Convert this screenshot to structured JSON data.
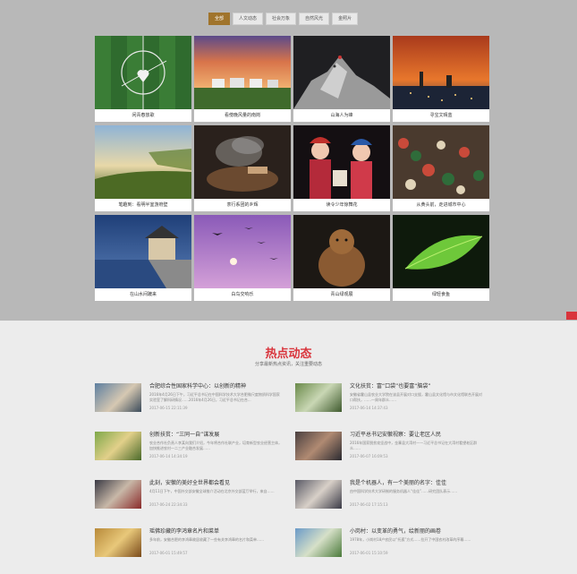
{
  "tabs": [
    "全部",
    "人文动态",
    "社会万象",
    "自然风光",
    "金照片"
  ],
  "photos": [
    {
      "caption": "闲青春放歌"
    },
    {
      "caption": "看傍晚风量的南岗"
    },
    {
      "caption": "山海人为峰"
    },
    {
      "caption": "寻宝文晴蓝"
    },
    {
      "caption": "笔趣到：看明半室游府壁"
    },
    {
      "caption": "茶行系团的乡辉"
    },
    {
      "caption": "读令少年惊舞花"
    },
    {
      "caption": "从黄头前，走进城市中心"
    },
    {
      "caption": "在山水间踱来"
    },
    {
      "caption": "白鸟交响乐"
    },
    {
      "caption": "青山绿观展"
    },
    {
      "caption": "绿轻食鱼"
    }
  ],
  "news": {
    "title": "热点动态",
    "subtitle": "分享最新热点资讯，关注重要动态",
    "items": [
      {
        "title": "合肥综合性国家科学中心：以创新的精神",
        "desc": "2016年4月26日下午，习近平总书记在中国科学技术大学合肥微尺度物质科学国家实验室了解科研情况……2016年4月26日，习近平总书记在合...",
        "date": "2017-06-15 22:11:39"
      },
      {
        "title": "文化扶贫：富“口袋”也要富“脑袋”",
        "desc": "安徽省霍山县农业大学院在该县开展对口支援，霍山县文化馆与市文化馆联合开展对口帮扶，……一周年群众……",
        "date": "2017-06-14 14:37:43"
      },
      {
        "title": "创新扶贫：“三同一自”谋发展",
        "desc": "农业合作社负责人李某向我们介绍，今年将合作社联产业，培育新型农业经营主体，加快推进农村一二三产业融合发展……",
        "date": "2017-06-14 14:34:19"
      },
      {
        "title": "习近平总书记安徽视察：要让老区人民",
        "desc": "2016年国家脱贫攻坚战中，金寨县大湾村——习近平总书记在大湾村看望老区群众……",
        "date": "2017-06-07 16:09:53"
      },
      {
        "title": "此刻，安徽的美好全世界都会看见",
        "desc": "4月11日下午，中国外交部安徽全球推介活动在北京外交部蓝厅举行，来自……",
        "date": "2017-06-24 22:34:33"
      },
      {
        "title": "我是个机器人，有一个美丽的名字：佳佳",
        "desc": "由中国科学技术大学研制的服务机器人“佳佳”……研究团队表示……",
        "date": "2017-06-02 17:15:13"
      },
      {
        "title": "瑶佛珍藏的李鸿章名片和菜单",
        "desc": "多年前，安徽合肥的李鸿章故居收藏了一些有关李鸿章的名片和菜单……",
        "date": "2017-06-01 15:49:57"
      },
      {
        "title": "小岗村：以变革的勇气，绘新丽的画卷",
        "desc": "1978年，小岗村18户农民以“托孤”方式……拉开了中国农村改革的序幕……",
        "date": "2017-06-01 15:10:59"
      }
    ]
  }
}
